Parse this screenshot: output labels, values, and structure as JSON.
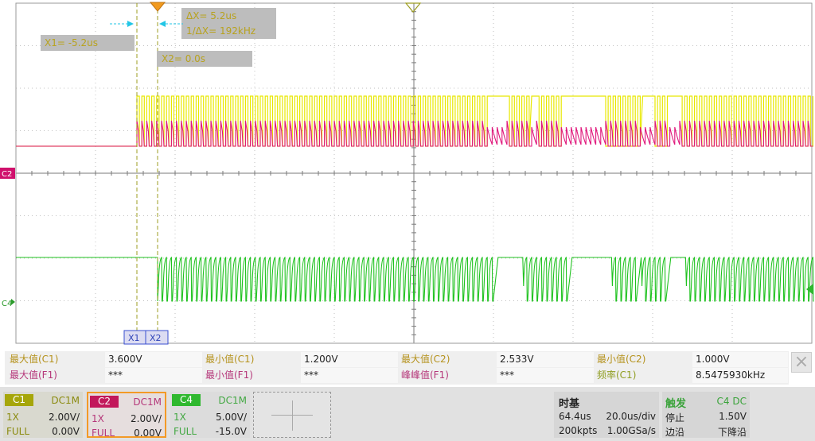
{
  "display": {
    "cursor_readouts": {
      "delta_x": "ΔX= 5.2us",
      "inv_delta_x": "1/ΔX= 192kHz",
      "x1": "X1= -5.2us",
      "x2": "X2= 0.0s"
    },
    "channel_markers": {
      "c2": "C2",
      "c4": "C4"
    },
    "cursor_tabs": {
      "x1": "X1",
      "x2": "X2"
    },
    "colors": {
      "grid": "#c0c0c0",
      "ch1": "#e8e800",
      "ch2": "#e0177c",
      "ch4": "#1fc21f",
      "cursor": "#9c9c20",
      "trigger": "#f39c12"
    }
  },
  "measurements": {
    "rows": [
      [
        {
          "label": "最大值(C1)",
          "value": "3.600V"
        },
        {
          "label": "最小值(C1)",
          "value": "1.200V"
        },
        {
          "label": "最大值(C2)",
          "value": "2.533V"
        },
        {
          "label": "最小值(C2)",
          "value": "1.000V"
        }
      ],
      [
        {
          "label": "最大值(F1)",
          "value": "***"
        },
        {
          "label": "最小值(F1)",
          "value": "***"
        },
        {
          "label": "峰峰值(F1)",
          "value": "***"
        },
        {
          "label": "频率(C1)",
          "value": "8.5475930kHz"
        }
      ]
    ],
    "close_icon": "×"
  },
  "channels": [
    {
      "tag": "C1",
      "coupling": "DC1M",
      "probe": "1X",
      "scale": "2.00V/",
      "bw": "FULL",
      "offset": "0.00V",
      "color": "#a6a60a",
      "box_bg": "#d9d9cf",
      "text_color": "#8b8b10"
    },
    {
      "tag": "C2",
      "coupling": "DC1M",
      "probe": "1X",
      "scale": "2.00V/",
      "bw": "FULL",
      "offset": "0.00V",
      "color": "#c2185b",
      "box_bg": "#e6dede",
      "text_color": "#b5377a",
      "selected": true
    },
    {
      "tag": "C4",
      "coupling": "DC1M",
      "probe": "1X",
      "scale": "5.00V/",
      "bw": "FULL",
      "offset": "-15.0V",
      "color": "#2eb82e",
      "box_bg": "#dcdcdc",
      "text_color": "#43a843"
    }
  ],
  "timebase": {
    "title": "时基",
    "delay": "64.4us",
    "scale": "20.0us/div",
    "memory": "200kpts",
    "sample_rate": "1.00GSa/s"
  },
  "trigger": {
    "title": "触发",
    "source": "C4 DC",
    "state": "停止",
    "level": "1.50V",
    "type": "边沿",
    "slope": "下降沿"
  }
}
